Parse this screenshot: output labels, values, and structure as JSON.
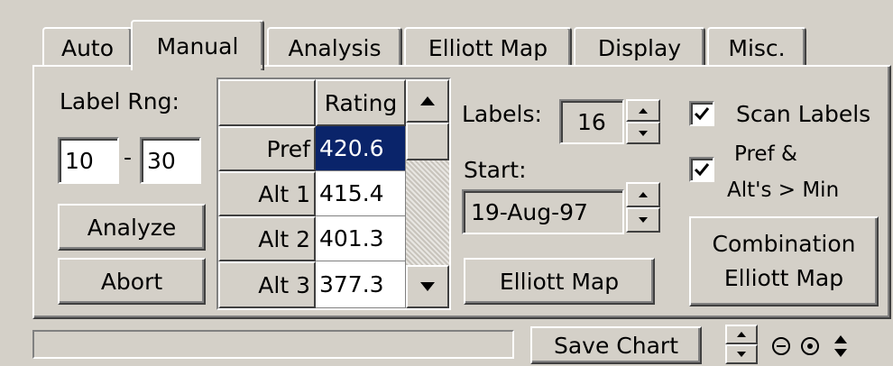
{
  "tabs": [
    {
      "label": "Auto",
      "active": false
    },
    {
      "label": "Manual",
      "active": true
    },
    {
      "label": "Analysis",
      "active": false
    },
    {
      "label": "Elliott Map",
      "active": false
    },
    {
      "label": "Display",
      "active": false
    },
    {
      "label": "Misc.",
      "active": false
    }
  ],
  "label_range": {
    "title": "Label Rng:",
    "from": "10",
    "separator": "-",
    "to": "30"
  },
  "buttons": {
    "analyze": "Analyze",
    "abort": "Abort",
    "elliott_map": "Elliott Map",
    "combination_line1": "Combination",
    "combination_line2": "Elliott Map",
    "save_chart": "Save Chart"
  },
  "grid": {
    "header": "Rating",
    "rows": [
      {
        "label": "Pref",
        "value": "420.6",
        "selected": true
      },
      {
        "label": "Alt 1",
        "value": "415.4",
        "selected": false
      },
      {
        "label": "Alt 2",
        "value": "401.3",
        "selected": false
      },
      {
        "label": "Alt 3",
        "value": "377.3",
        "selected": false
      }
    ]
  },
  "labels_field": {
    "title": "Labels:",
    "value": "16"
  },
  "start_field": {
    "title": "Start:",
    "value": "19-Aug-97"
  },
  "checkboxes": {
    "scan_labels": {
      "label": "Scan Labels",
      "checked": true
    },
    "pref_alts": {
      "line1": "Pref &",
      "line2": "Alt's > Min",
      "checked": true
    }
  },
  "status": {
    "text": ""
  },
  "colors": {
    "face": "#d4d0c8",
    "selection": "#0a246a"
  }
}
